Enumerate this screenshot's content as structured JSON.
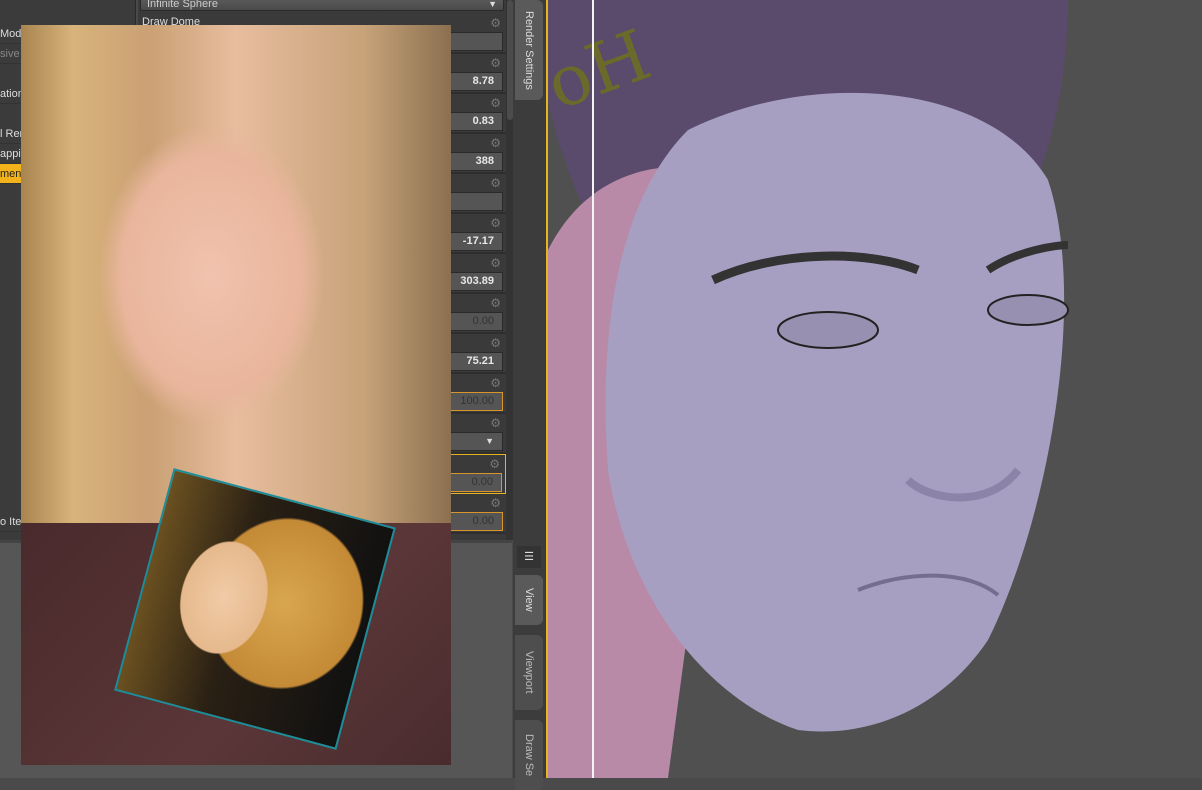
{
  "left_panel": {
    "items": [
      "Mod",
      "sive",
      "ation",
      "l Ren",
      "appin",
      "ment",
      "o Iter"
    ],
    "selected": "ment"
  },
  "settings": {
    "dome_mode": "Infinite Sphere",
    "draw_dome_label": "Draw Dome",
    "values": [
      "8.78",
      "0.83",
      "388",
      "-17.17",
      "303.89",
      "0.00",
      "75.21",
      "100.00",
      "0.00",
      "0.00"
    ]
  },
  "tabs": {
    "render_settings": "Render Settings",
    "view": "View",
    "viewport": "Viewport",
    "draw_settings": "Draw Se"
  },
  "icons": {
    "gear": "⚙",
    "arrow_down": "▼",
    "plus": "+",
    "menu": "☰"
  },
  "colors": {
    "accent": "#f2b21b",
    "highlight_border": "#d9952a",
    "viewport_bg": "#505050",
    "model": "#a79fc1"
  }
}
